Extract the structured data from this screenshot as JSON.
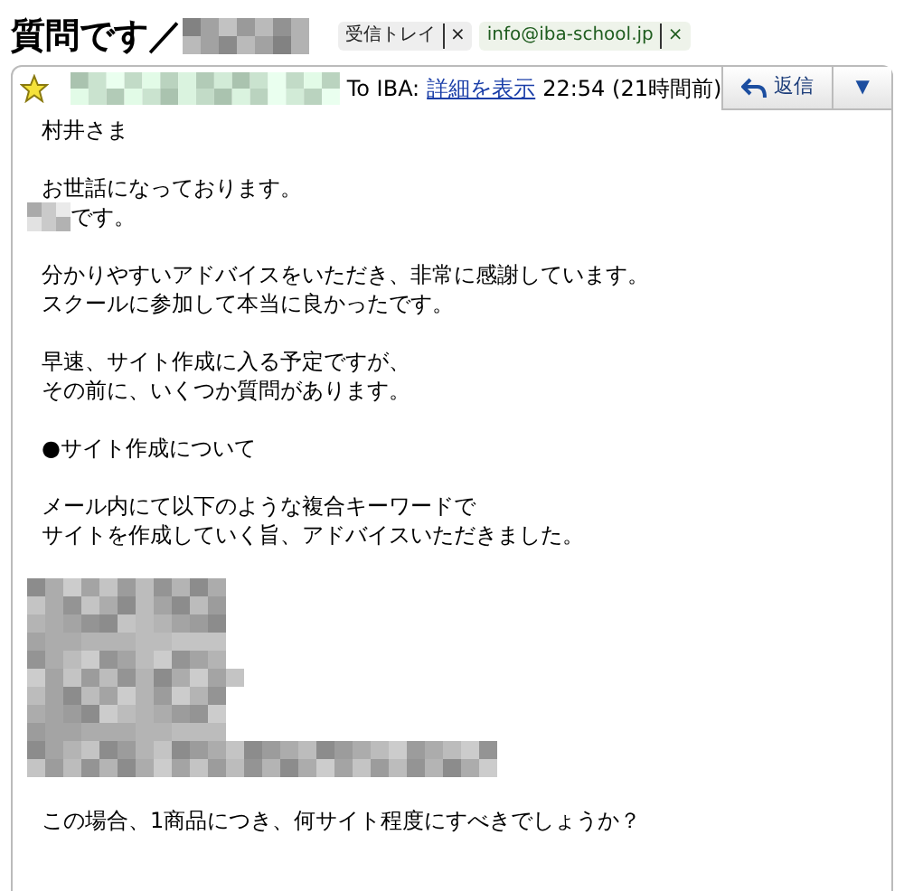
{
  "subject": {
    "text": "質問です／",
    "redacted_suffix": true
  },
  "labels": [
    {
      "text": "受信トレイ",
      "remove": "×",
      "color": "#eeeeee"
    },
    {
      "text": "info@iba-school.jp",
      "remove": "×",
      "color": "#eef3ea"
    }
  ],
  "message": {
    "starred": true,
    "sender_redacted": true,
    "to": "To IBA:",
    "details_link": "詳細を表示",
    "time": "22:54 (21時間前)",
    "reply_button": "返信",
    "more_button": "▼"
  },
  "body": [
    {
      "kind": "paragraph",
      "lines": [
        {
          "text": "村井さま"
        }
      ]
    },
    {
      "kind": "paragraph",
      "lines": [
        {
          "text": "お世話になっております。"
        },
        {
          "text": "です。",
          "redacted_prefix": true
        }
      ]
    },
    {
      "kind": "paragraph",
      "lines": [
        {
          "text": "分かりやすいアドバイスをいただき、非常に感謝しています。"
        },
        {
          "text": "スクールに参加して本当に良かったです。"
        }
      ]
    },
    {
      "kind": "paragraph",
      "lines": [
        {
          "text": "早速、サイト作成に入る予定ですが、"
        },
        {
          "text": "その前に、いくつか質問があります。"
        }
      ]
    },
    {
      "kind": "heading",
      "lines": [
        {
          "text": "●サイト作成について"
        }
      ]
    },
    {
      "kind": "paragraph",
      "lines": [
        {
          "text": "メール内にて以下のような複合キーワードで"
        },
        {
          "text": "サイトを作成していく旨、アドバイスいただきました。"
        }
      ]
    },
    {
      "kind": "redacted_block"
    },
    {
      "kind": "paragraph",
      "lines": [
        {
          "text": "この場合、1商品につき、何サイト程度にすべきでしょうか？"
        }
      ]
    }
  ]
}
